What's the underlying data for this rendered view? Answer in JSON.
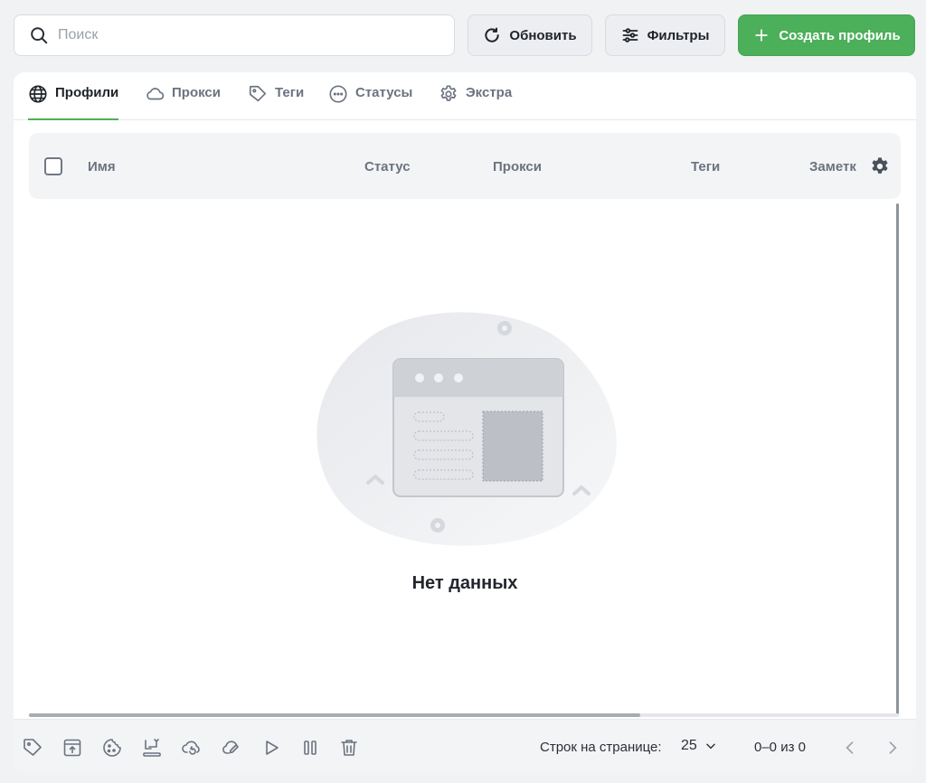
{
  "search": {
    "placeholder": "Поиск",
    "value": ""
  },
  "toolbar": {
    "refresh_label": "Обновить",
    "filters_label": "Фильтры",
    "create_label": "Создать профиль"
  },
  "tabs": [
    {
      "label": "Профили",
      "icon": "globe-icon",
      "active": true
    },
    {
      "label": "Прокси",
      "icon": "cloud-icon",
      "active": false
    },
    {
      "label": "Теги",
      "icon": "tag-icon",
      "active": false
    },
    {
      "label": "Статусы",
      "icon": "status-dots-icon",
      "active": false
    },
    {
      "label": "Экстра",
      "icon": "gear-icon",
      "active": false
    }
  ],
  "table": {
    "columns": [
      "Имя",
      "Статус",
      "Прокси",
      "Теги",
      "Заметк"
    ],
    "empty_text": "Нет данных"
  },
  "footer": {
    "actions": [
      "tag-icon",
      "upload-icon",
      "cookie-icon",
      "transfer-icon",
      "cloud-sync-icon",
      "cloud-edit-icon",
      "play-icon",
      "pause-icon",
      "trash-icon"
    ],
    "rows_label": "Строк на странице:",
    "rows_value": "25",
    "range": "0–0 из 0"
  },
  "colors": {
    "accent": "#4caf5a",
    "background": "#f1f2f4"
  }
}
